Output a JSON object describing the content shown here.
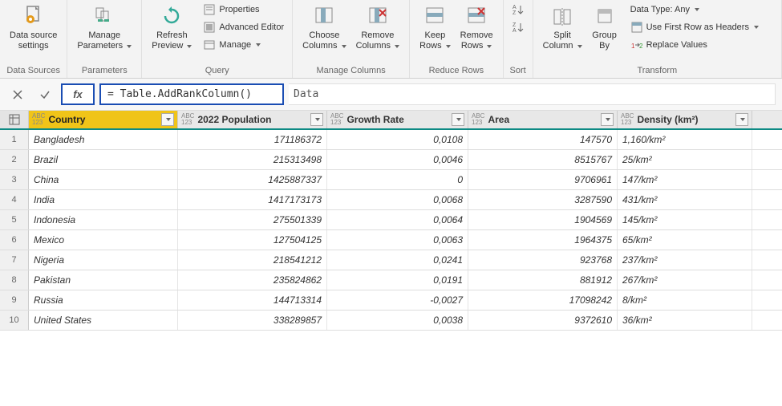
{
  "ribbon": {
    "data_source_settings": "Data source\nsettings",
    "data_sources_group": "Data Sources",
    "manage_parameters": "Manage\nParameters",
    "parameters_group": "Parameters",
    "refresh_preview": "Refresh\nPreview",
    "properties": "Properties",
    "advanced_editor": "Advanced Editor",
    "manage": "Manage",
    "query_group": "Query",
    "choose_columns": "Choose\nColumns",
    "remove_columns": "Remove\nColumns",
    "manage_columns_group": "Manage Columns",
    "keep_rows": "Keep\nRows",
    "remove_rows": "Remove\nRows",
    "reduce_rows_group": "Reduce Rows",
    "sort_group": "Sort",
    "split_column": "Split\nColumn",
    "group_by": "Group\nBy",
    "data_type": "Data Type: Any",
    "first_row_headers": "Use First Row as Headers",
    "replace_values": "Replace Values",
    "transform_group": "Transform"
  },
  "formula": {
    "fx_label": "fx",
    "expr": "= Table.AddRankColumn()",
    "extra": "Data"
  },
  "columns": [
    {
      "name": "Country",
      "selected": true,
      "w": "w-country",
      "align": "left"
    },
    {
      "name": "2022 Population",
      "selected": false,
      "w": "w-pop",
      "align": "num"
    },
    {
      "name": "Growth Rate",
      "selected": false,
      "w": "w-growth",
      "align": "num"
    },
    {
      "name": "Area",
      "selected": false,
      "w": "w-area",
      "align": "num"
    },
    {
      "name": "Density (km²)",
      "selected": false,
      "w": "w-density",
      "align": "left"
    }
  ],
  "rows": [
    {
      "n": 1,
      "country": "Bangladesh",
      "pop": "171186372",
      "growth": "0,0108",
      "area": "147570",
      "density": "1,160/km²"
    },
    {
      "n": 2,
      "country": "Brazil",
      "pop": "215313498",
      "growth": "0,0046",
      "area": "8515767",
      "density": "25/km²"
    },
    {
      "n": 3,
      "country": "China",
      "pop": "1425887337",
      "growth": "0",
      "area": "9706961",
      "density": "147/km²"
    },
    {
      "n": 4,
      "country": "India",
      "pop": "1417173173",
      "growth": "0,0068",
      "area": "3287590",
      "density": "431/km²"
    },
    {
      "n": 5,
      "country": "Indonesia",
      "pop": "275501339",
      "growth": "0,0064",
      "area": "1904569",
      "density": "145/km²"
    },
    {
      "n": 6,
      "country": "Mexico",
      "pop": "127504125",
      "growth": "0,0063",
      "area": "1964375",
      "density": "65/km²"
    },
    {
      "n": 7,
      "country": "Nigeria",
      "pop": "218541212",
      "growth": "0,0241",
      "area": "923768",
      "density": "237/km²"
    },
    {
      "n": 8,
      "country": "Pakistan",
      "pop": "235824862",
      "growth": "0,0191",
      "area": "881912",
      "density": "267/km²"
    },
    {
      "n": 9,
      "country": "Russia",
      "pop": "144713314",
      "growth": "-0,0027",
      "area": "17098242",
      "density": "8/km²"
    },
    {
      "n": 10,
      "country": "United States",
      "pop": "338289857",
      "growth": "0,0038",
      "area": "9372610",
      "density": "36/km²"
    }
  ]
}
